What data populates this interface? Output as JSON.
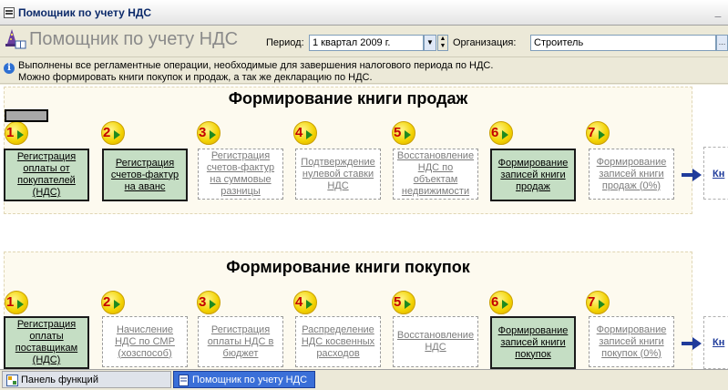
{
  "window": {
    "title": "Помощник по учету НДС"
  },
  "header": {
    "app_title": "Помощник по учету НДС",
    "period_label": "Период:",
    "period_value": "1 квартал 2009 г.",
    "org_label": "Организация:",
    "org_value": "Строитель"
  },
  "info": {
    "line1": "Выполнены все регламентные операции, необходимые для завершения налогового периода по НДС.",
    "line2": "Можно формировать книги покупок и продаж, а так же декларацию по НДС."
  },
  "sales": {
    "title": "Формирование книги продаж",
    "steps": [
      {
        "num": "1",
        "label": "Регистрация оплаты от покупателей (НДС)",
        "state": "active"
      },
      {
        "num": "2",
        "label": "Регистрация счетов-фактур на аванс",
        "state": "active"
      },
      {
        "num": "3",
        "label": "Регистрация счетов-фактур на суммовые разницы",
        "state": "inactive"
      },
      {
        "num": "4",
        "label": "Подтверждение нулевой ставки НДС",
        "state": "inactive"
      },
      {
        "num": "5",
        "label": "Восстановление НДС по объектам недвижимости",
        "state": "inactive"
      },
      {
        "num": "6",
        "label": "Формирование записей книги продаж",
        "state": "active"
      },
      {
        "num": "7",
        "label": "Формирование записей книги продаж (0%)",
        "state": "inactive"
      }
    ],
    "next_link": "Кн"
  },
  "purchases": {
    "title": "Формирование книги покупок",
    "steps": [
      {
        "num": "1",
        "label": "Регистрация оплаты поставщикам (НДС)",
        "state": "active"
      },
      {
        "num": "2",
        "label": "Начисление НДС по СМР (хозспособ)",
        "state": "inactive"
      },
      {
        "num": "3",
        "label": "Регистрация оплаты НДС в бюджет",
        "state": "inactive"
      },
      {
        "num": "4",
        "label": "Распределение НДС косвенных расходов",
        "state": "inactive"
      },
      {
        "num": "5",
        "label": "Восстановление НДС",
        "state": "inactive"
      },
      {
        "num": "6",
        "label": "Формирование записей книги покупок",
        "state": "active"
      },
      {
        "num": "7",
        "label": "Формирование записей книги покупок (0%)",
        "state": "inactive"
      }
    ],
    "next_link": "Кн"
  },
  "taskbar": {
    "items": [
      {
        "label": "Панель функций",
        "active": false
      },
      {
        "label": "Помощник по учету НДС",
        "active": true
      }
    ]
  },
  "colors": {
    "active_step_bg": "#c5dec4",
    "link_blue": "#1f3b9b",
    "badge_yellow": "#f2d100",
    "badge_number": "#c40000"
  }
}
